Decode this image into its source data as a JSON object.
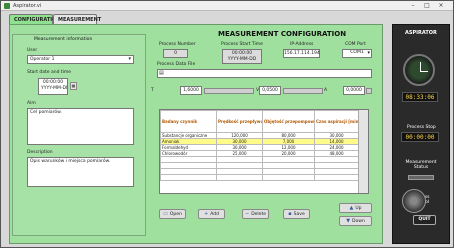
{
  "window": {
    "title": "Aspirator.vi"
  },
  "tabs": [
    {
      "label": "CONFIGURATION",
      "active": true
    },
    {
      "label": "MEASUREMENT",
      "active": false
    }
  ],
  "left_panel": {
    "heading": "Measurement information",
    "user_label": "User",
    "user_value": "Operator 1",
    "start_label": "Start date and time",
    "start_time": "00:00:00",
    "start_date": "YYYY-MM-DD",
    "aim_label": "Aim",
    "aim_value": "Cel pomiarów.",
    "description_label": "Description",
    "description_value": "Opis warunków i miejsca pomiarów."
  },
  "config": {
    "heading": "MEASUREMENT CONFIGURATION",
    "process_number_label": "Process Number",
    "process_number_value": "0",
    "process_start_label": "Process Start Time",
    "process_start_time": "00:00:00",
    "process_start_date": "YYYY-MM-DD",
    "ip_label": "IP-Address",
    "ip_value": "156.17.114.194",
    "com_label": "COM Port",
    "com_value": "COM1",
    "data_file_label": "Process Data File",
    "t_label": "T",
    "t_value": "1,6000",
    "v_label": "V",
    "v_value": "0,0500",
    "a_label": "A",
    "a_value": "0,0000"
  },
  "table": {
    "headers": [
      "Badany czynnik",
      "Prędkość przepływu gazu [l/h]",
      "Objętość przepompowanego gazu [l]",
      "Czas aspiracji [min]"
    ],
    "rows": [
      [
        "Substancje organiczne",
        "120,000",
        "80,000",
        "30,000"
      ],
      [
        "Amoniak",
        "30,000",
        "7,000",
        "14,000"
      ],
      [
        "Formaldehyd",
        "30,000",
        "12,000",
        "24,000"
      ],
      [
        "Chlorowodór",
        "25,000",
        "20,000",
        "48,000"
      ]
    ],
    "selected_row": 1
  },
  "actions": {
    "open": "Open",
    "add": "Add",
    "delete": "Delete",
    "save": "Save",
    "up": "Up",
    "down": "Down"
  },
  "right_panel": {
    "title": "ASPIRATOR",
    "clock_time": "08:33:06",
    "process_stop_label": "Process Stop",
    "process_stop_time": "00:00:00",
    "measurement_status_label": "Measurement Status",
    "process_control_label": "Process Control",
    "quit_label": "QUIT"
  },
  "colors": {
    "accent_green": "#9fe09f",
    "highlight_yellow": "#fffb8a",
    "header_orange": "#b35a00"
  }
}
